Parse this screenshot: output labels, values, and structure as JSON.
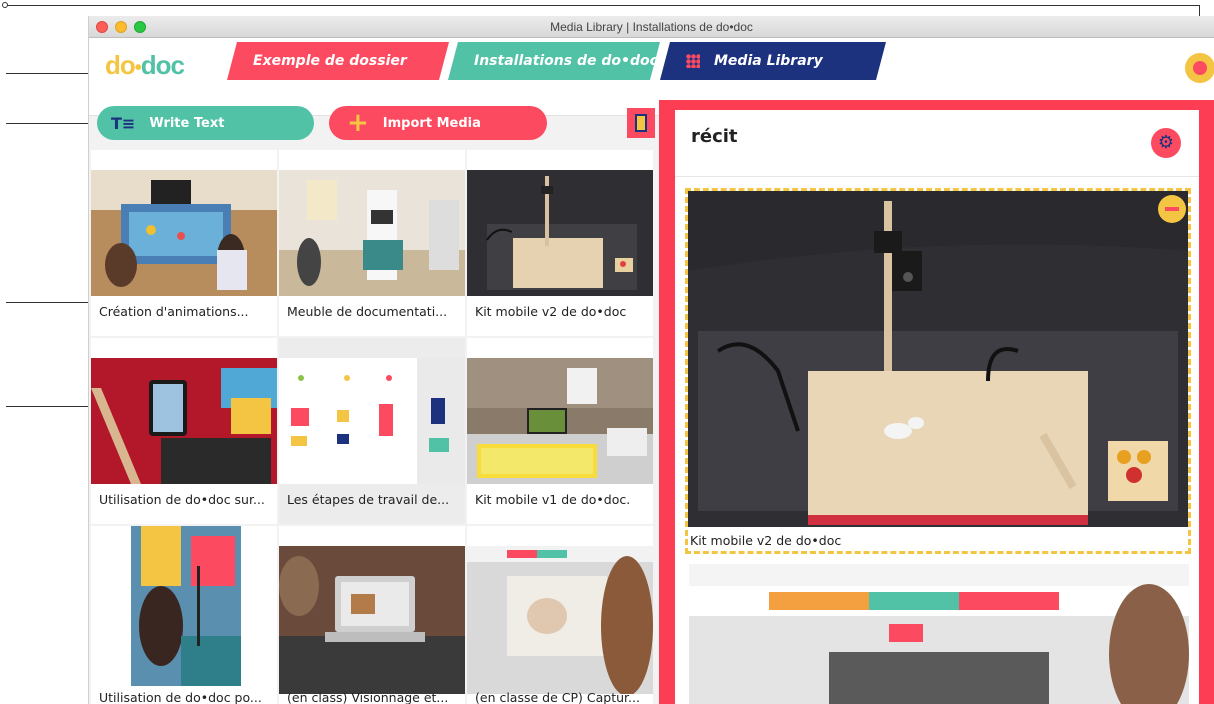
{
  "window": {
    "title": "Media Library | Installations de do•doc"
  },
  "logo": {
    "part1": "do",
    "dot": "•",
    "part2": "doc"
  },
  "breadcrumbs": [
    {
      "label": "Exemple de dossier",
      "color": "#fc4b60"
    },
    {
      "label": "Installations de do•doc",
      "color": "#52c2a7"
    },
    {
      "label": "Media Library",
      "color": "#1d327f",
      "icon": "grid-icon"
    }
  ],
  "actions": {
    "write_text": {
      "label": "Write Text",
      "icon": "text-icon"
    },
    "import_media": {
      "label": "Import Media",
      "icon": "plus-icon"
    }
  },
  "media": [
    {
      "caption": "Création d'animations..."
    },
    {
      "caption": "Meuble de documentati..."
    },
    {
      "caption": "Kit mobile v2 de do•doc"
    },
    {
      "caption": "Utilisation de do•doc sur..."
    },
    {
      "caption": "Les étapes de travail de..."
    },
    {
      "caption": "Kit mobile v1 de do•doc."
    },
    {
      "caption": "Utilisation de do•doc po..."
    },
    {
      "caption": "(en class) Visionnage et..."
    },
    {
      "caption": "(en classe de CP) Captur..."
    }
  ],
  "recit": {
    "title": "récit",
    "selected_caption": "Kit mobile v2 de do•doc"
  },
  "colors": {
    "red": "#fc4b60",
    "teal": "#52c2a7",
    "navy": "#1d327f",
    "yellow": "#f4c542"
  }
}
